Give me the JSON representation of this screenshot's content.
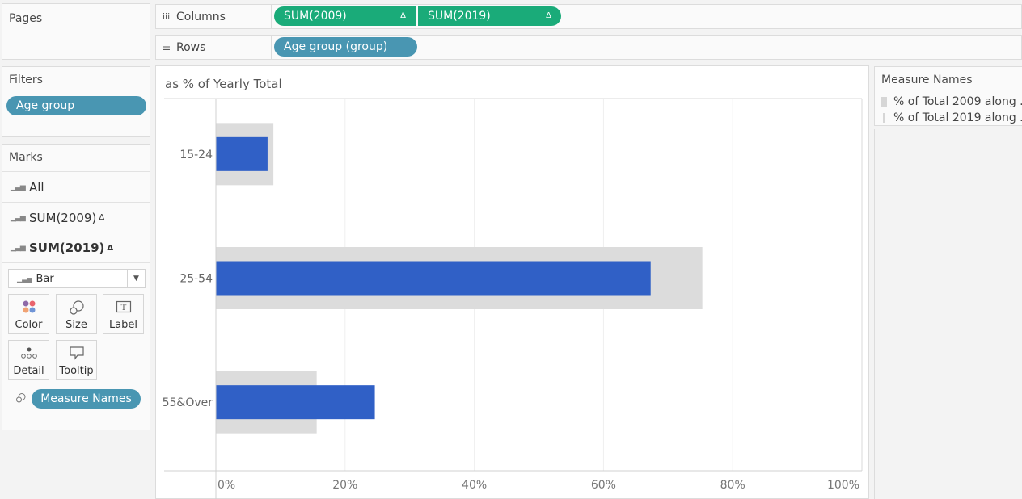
{
  "pages": {
    "title": "Pages"
  },
  "shelves": {
    "columns": {
      "label": "Columns",
      "icon": "columns-icon",
      "pills": [
        {
          "label": "SUM(2009)",
          "delta": "Δ"
        },
        {
          "label": "SUM(2019)",
          "delta": "Δ"
        }
      ]
    },
    "rows": {
      "label": "Rows",
      "icon": "rows-icon",
      "pills": [
        {
          "label": "Age group (group)"
        }
      ]
    }
  },
  "filters": {
    "title": "Filters",
    "pills": [
      {
        "label": "Age group"
      }
    ]
  },
  "marks": {
    "title": "Marks",
    "rows": [
      {
        "label": "All",
        "delta": ""
      },
      {
        "label": "SUM(2009)",
        "delta": "Δ"
      },
      {
        "label": "SUM(2019)",
        "delta": "Δ"
      }
    ],
    "mark_type": "Bar",
    "buttons": {
      "color": "Color",
      "size": "Size",
      "label": "Label",
      "detail": "Detail",
      "tooltip": "Tooltip"
    },
    "color_field": "Measure Names"
  },
  "legend": {
    "title": "Measure Names",
    "items": [
      {
        "label": "% of Total 2009 along ..",
        "color": "#d6d6d6"
      },
      {
        "label": "% of Total 2019 along ..",
        "color": "#d6d6d6"
      }
    ]
  },
  "colors": {
    "bar_2009": "#dcdcdc",
    "bar_2019": "#3060c6",
    "pill_green": "#1aab79",
    "pill_blue": "#4996b2"
  },
  "chart_data": {
    "type": "bar",
    "orientation": "horizontal",
    "title": "as % of Yearly Total",
    "xlabel": "",
    "ylabel": "",
    "categories": [
      "15-24",
      "25-54",
      "55&Over"
    ],
    "series": [
      {
        "name": "% of Total 2009",
        "values": [
          8.9,
          75.3,
          15.6
        ]
      },
      {
        "name": "% of Total 2019",
        "values": [
          8.0,
          67.3,
          24.6
        ]
      }
    ],
    "xlim": [
      0,
      100
    ],
    "xticks": [
      "0%",
      "20%",
      "40%",
      "60%",
      "80%",
      "100%"
    ],
    "xtick_values": [
      0,
      20,
      40,
      60,
      80,
      100
    ],
    "grid": true,
    "legend": "right"
  }
}
